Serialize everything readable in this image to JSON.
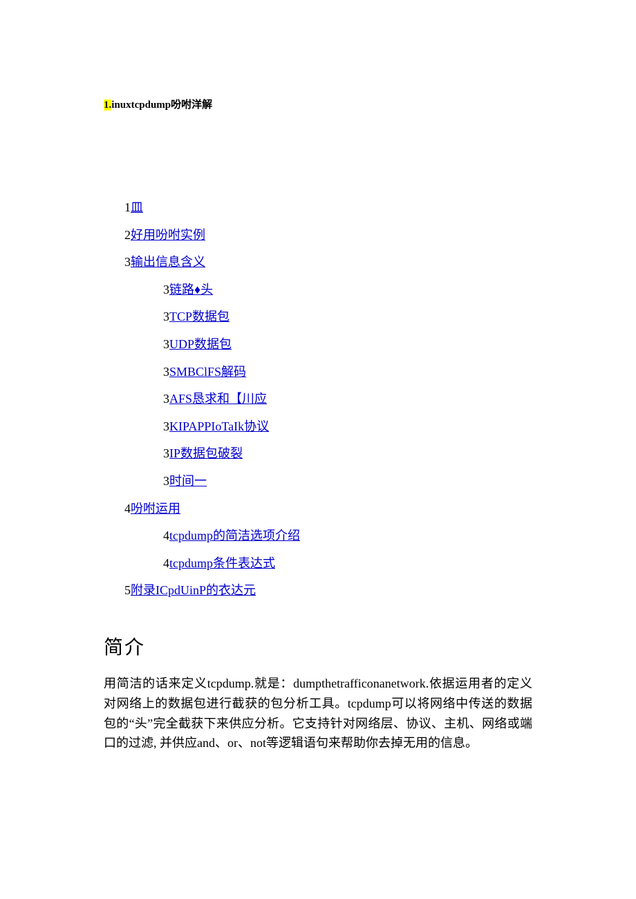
{
  "title_prefix_hl": "1.",
  "title_rest": "inuxtcpdump吩咐洋解",
  "toc": [
    {
      "level": 1,
      "num": "1",
      "text": "皿"
    },
    {
      "level": 1,
      "num": "2",
      "text": "好用吩咐实例"
    },
    {
      "level": 1,
      "num": "3",
      "text": "输出信息含义"
    },
    {
      "level": 2,
      "num": "3",
      "text": "链路♦头"
    },
    {
      "level": 2,
      "num": "3",
      "text": "TCP数据包"
    },
    {
      "level": 2,
      "num": "3",
      "text": "UDP数据包"
    },
    {
      "level": 2,
      "num": "3",
      "text": "SMBClFS解码"
    },
    {
      "level": 2,
      "num": "3",
      "text": "AFS恳求和【川应"
    },
    {
      "level": 2,
      "num": "3",
      "text": "KIPAPPIoTaIk协议"
    },
    {
      "level": 2,
      "num": "3",
      "text": "IP数据包破裂"
    },
    {
      "level": 2,
      "num": "3",
      "text": "时间一"
    },
    {
      "level": 1,
      "num": "4",
      "text": "吩咐运用"
    },
    {
      "level": 2,
      "num": "4",
      "text": "tcpdump的简洁选项介绍"
    },
    {
      "level": 2,
      "num": "4",
      "text": "tcpdump条件表达式"
    },
    {
      "level": 1,
      "num": "5",
      "text": "附录ICpdUinP的衣达元"
    }
  ],
  "section_heading": "简介",
  "paragraph_text": "用简洁的话来定义tcpdump.就是：dumpthetrafficonanetwork.依据运用者的定义对网络上的数据包进行截获的包分析工具。tcpdump可以将网络中传送的数据包的“头”完全截获下来供应分析。它支持针对网络层、协议、主机、网络或端口的过滤, 并供应and、or、not等逻辑语句来帮助你去掉无用的信息。"
}
